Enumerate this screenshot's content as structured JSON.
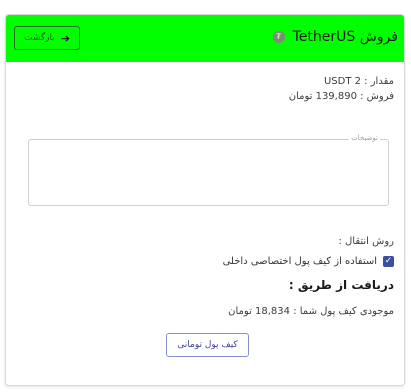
{
  "header": {
    "title": "فروش TetherUS",
    "coin_icon": "tether-coin-icon",
    "back_label": "بازگشت",
    "back_icon": "arrow-right-icon",
    "background_color": "#00ff00"
  },
  "info": {
    "amount": "مقدار : USDT 2",
    "sale": "فروش : 139,890 تومان"
  },
  "description": {
    "label": "توضیحات"
  },
  "transfer": {
    "method_label": "روش انتقال :",
    "internal_wallet_label": "استفاده از کیف پول اختصاصی داخلی",
    "internal_wallet_checked": true
  },
  "receive": {
    "title": "دریافت از طریق :",
    "balance": "موجودی کیف پول شما : 18,834 تومان",
    "wallet_button": "کیف پول تومانی"
  }
}
